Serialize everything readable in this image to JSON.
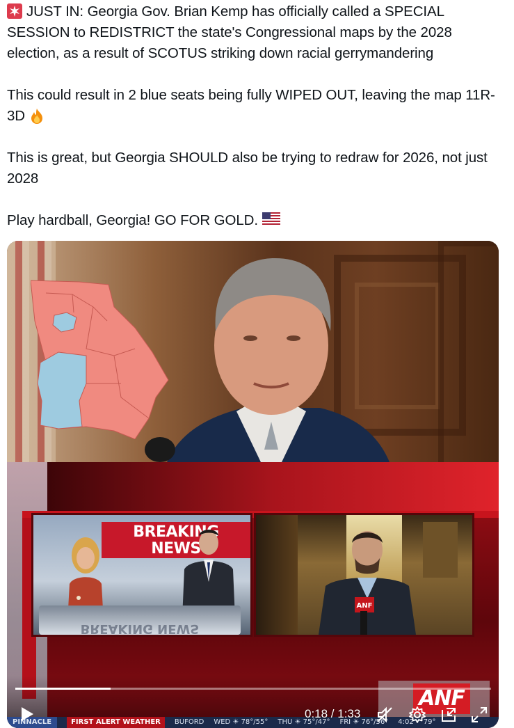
{
  "tweet": {
    "paragraphs": [
      {
        "emoji": "rotating-light",
        "text": "JUST IN: Georgia Gov. Brian Kemp has officially called a SPECIAL SESSION to REDISTRICT the state's Congressional maps by the 2028 election, as a result of SCOTUS striking down racial gerrymandering"
      },
      {
        "text": "This could result in 2 blue seats being fully WIPED OUT, leaving the map 11R-3D",
        "emoji_after": "fire"
      },
      {
        "text": "This is great, but Georgia SHOULD also be trying to redraw for 2026, not just 2028"
      },
      {
        "text": "Play hardball, Georgia! GO FOR GOLD.",
        "emoji_after": "us-flag"
      }
    ]
  },
  "video": {
    "breaking_line1": "BREAKING",
    "breaking_line2": "NEWS",
    "desk_text": "BREAKING NEWS",
    "mic_logo": "ANF",
    "network_logo": "ANF",
    "current_time": "0:18",
    "duration": "1:33",
    "time_display": "0:18 / 1:33",
    "progress_fraction": 0.2,
    "ticker": {
      "station": "PINNACLE",
      "badge": "FIRST ALERT WEATHER",
      "city": "BUFORD",
      "days": [
        "WED ☀ 78°/55°",
        "THU ☀ 75°/47°",
        "FRI ☀ 76°/56°"
      ],
      "clock": "4:02",
      "temp": "79°"
    },
    "controls": {
      "play": "play-icon",
      "mute": "mute-icon",
      "settings": "gear-icon",
      "pip": "picture-in-picture-icon",
      "fullscreen": "fullscreen-icon"
    }
  },
  "colors": {
    "map_red": "#f08a80",
    "map_blue": "#9ecbe0",
    "broadcast_red": "#a60e17"
  }
}
